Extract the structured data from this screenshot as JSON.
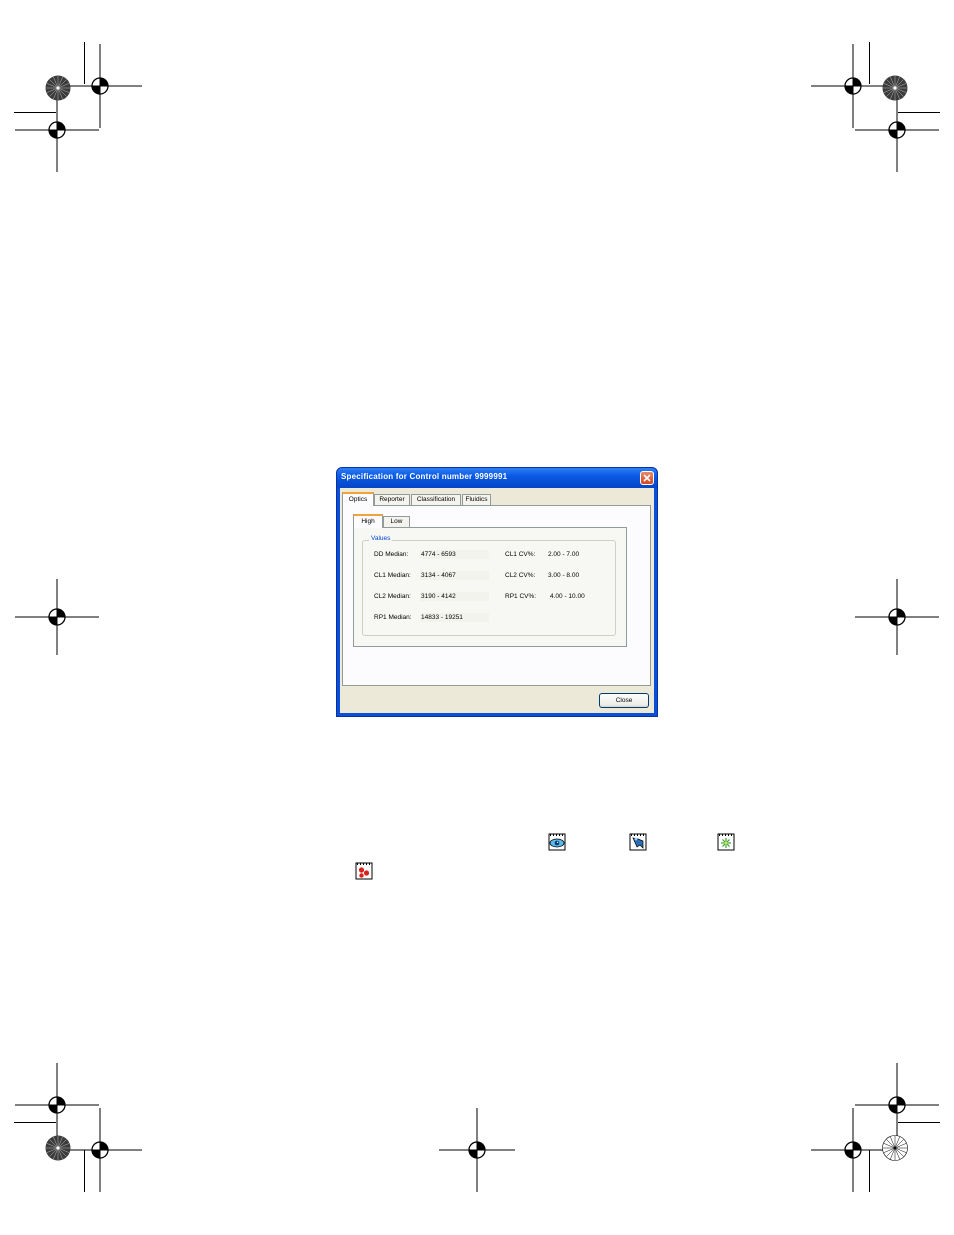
{
  "dialog": {
    "title": "Specification for Control number 9999991",
    "tabs": [
      "Optics",
      "Reporter",
      "Classification",
      "Fluidics"
    ],
    "active_tab": "Optics",
    "subtabs": [
      "High",
      "Low"
    ],
    "active_subtab": "High",
    "group_label": "Values",
    "rows": [
      {
        "label": "DD Median:",
        "value": "4774 - 6593"
      },
      {
        "label": "CL1 Median:",
        "value": "3134 - 4067"
      },
      {
        "label": "CL2 Median:",
        "value": "3190 - 4142"
      },
      {
        "label": "RP1 Median:",
        "value": "14833 - 19251"
      }
    ],
    "cv_rows": [
      {
        "label": "CL1 CV%:",
        "value": "2.00 - 7.00"
      },
      {
        "label": "CL2 CV%:",
        "value": "3.00 - 8.00"
      },
      {
        "label": "RP1 CV%:",
        "value": "4.00 - 10.00"
      }
    ],
    "close_label": "Close"
  },
  "icons": [
    "optics-view-icon",
    "reporter-icon",
    "classification-icon",
    "fluidics-icon"
  ],
  "colors": {
    "titlebar": "#0a5ae3",
    "tab_highlight": "#f1a33a",
    "group_label": "#0046d5",
    "close_button": "#d44826"
  }
}
